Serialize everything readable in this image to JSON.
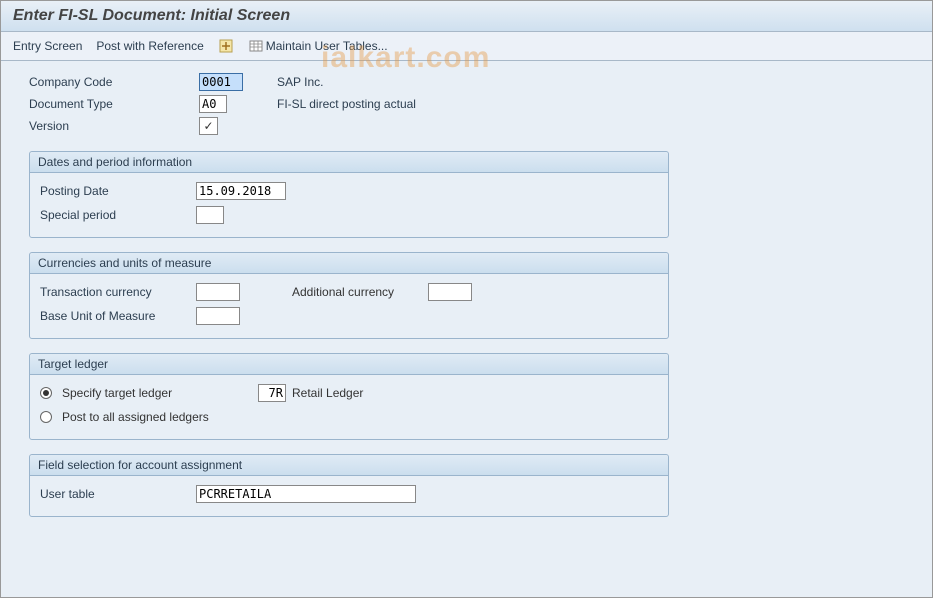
{
  "title": "Enter FI-SL Document: Initial Screen",
  "toolbar": {
    "entry_screen": "Entry Screen",
    "post_with_reference": "Post with Reference",
    "maintain_user_tables": "Maintain User Tables..."
  },
  "header_fields": {
    "company_code": {
      "label": "Company Code",
      "value": "0001",
      "desc": "SAP Inc."
    },
    "document_type": {
      "label": "Document Type",
      "value": "A0",
      "desc": "FI-SL direct posting actual"
    },
    "version": {
      "label": "Version",
      "checked": true
    }
  },
  "groups": {
    "dates": {
      "title": "Dates and period information",
      "posting_date": {
        "label": "Posting Date",
        "value": "15.09.2018"
      },
      "special_period": {
        "label": "Special period",
        "value": ""
      }
    },
    "currencies": {
      "title": "Currencies and units of measure",
      "transaction_currency": {
        "label": "Transaction currency",
        "value": ""
      },
      "additional_currency": {
        "label": "Additional currency",
        "value": ""
      },
      "base_uom": {
        "label": "Base Unit of Measure",
        "value": ""
      }
    },
    "target_ledger": {
      "title": "Target ledger",
      "specify": {
        "label": "Specify target ledger",
        "value": "7R",
        "desc": "Retail Ledger",
        "selected": true
      },
      "post_all": {
        "label": "Post to all assigned ledgers",
        "selected": false
      }
    },
    "field_selection": {
      "title": "Field selection for account assignment",
      "user_table": {
        "label": "User table",
        "value": "PCRRETAILA"
      }
    }
  },
  "watermark": "ialkart.com"
}
